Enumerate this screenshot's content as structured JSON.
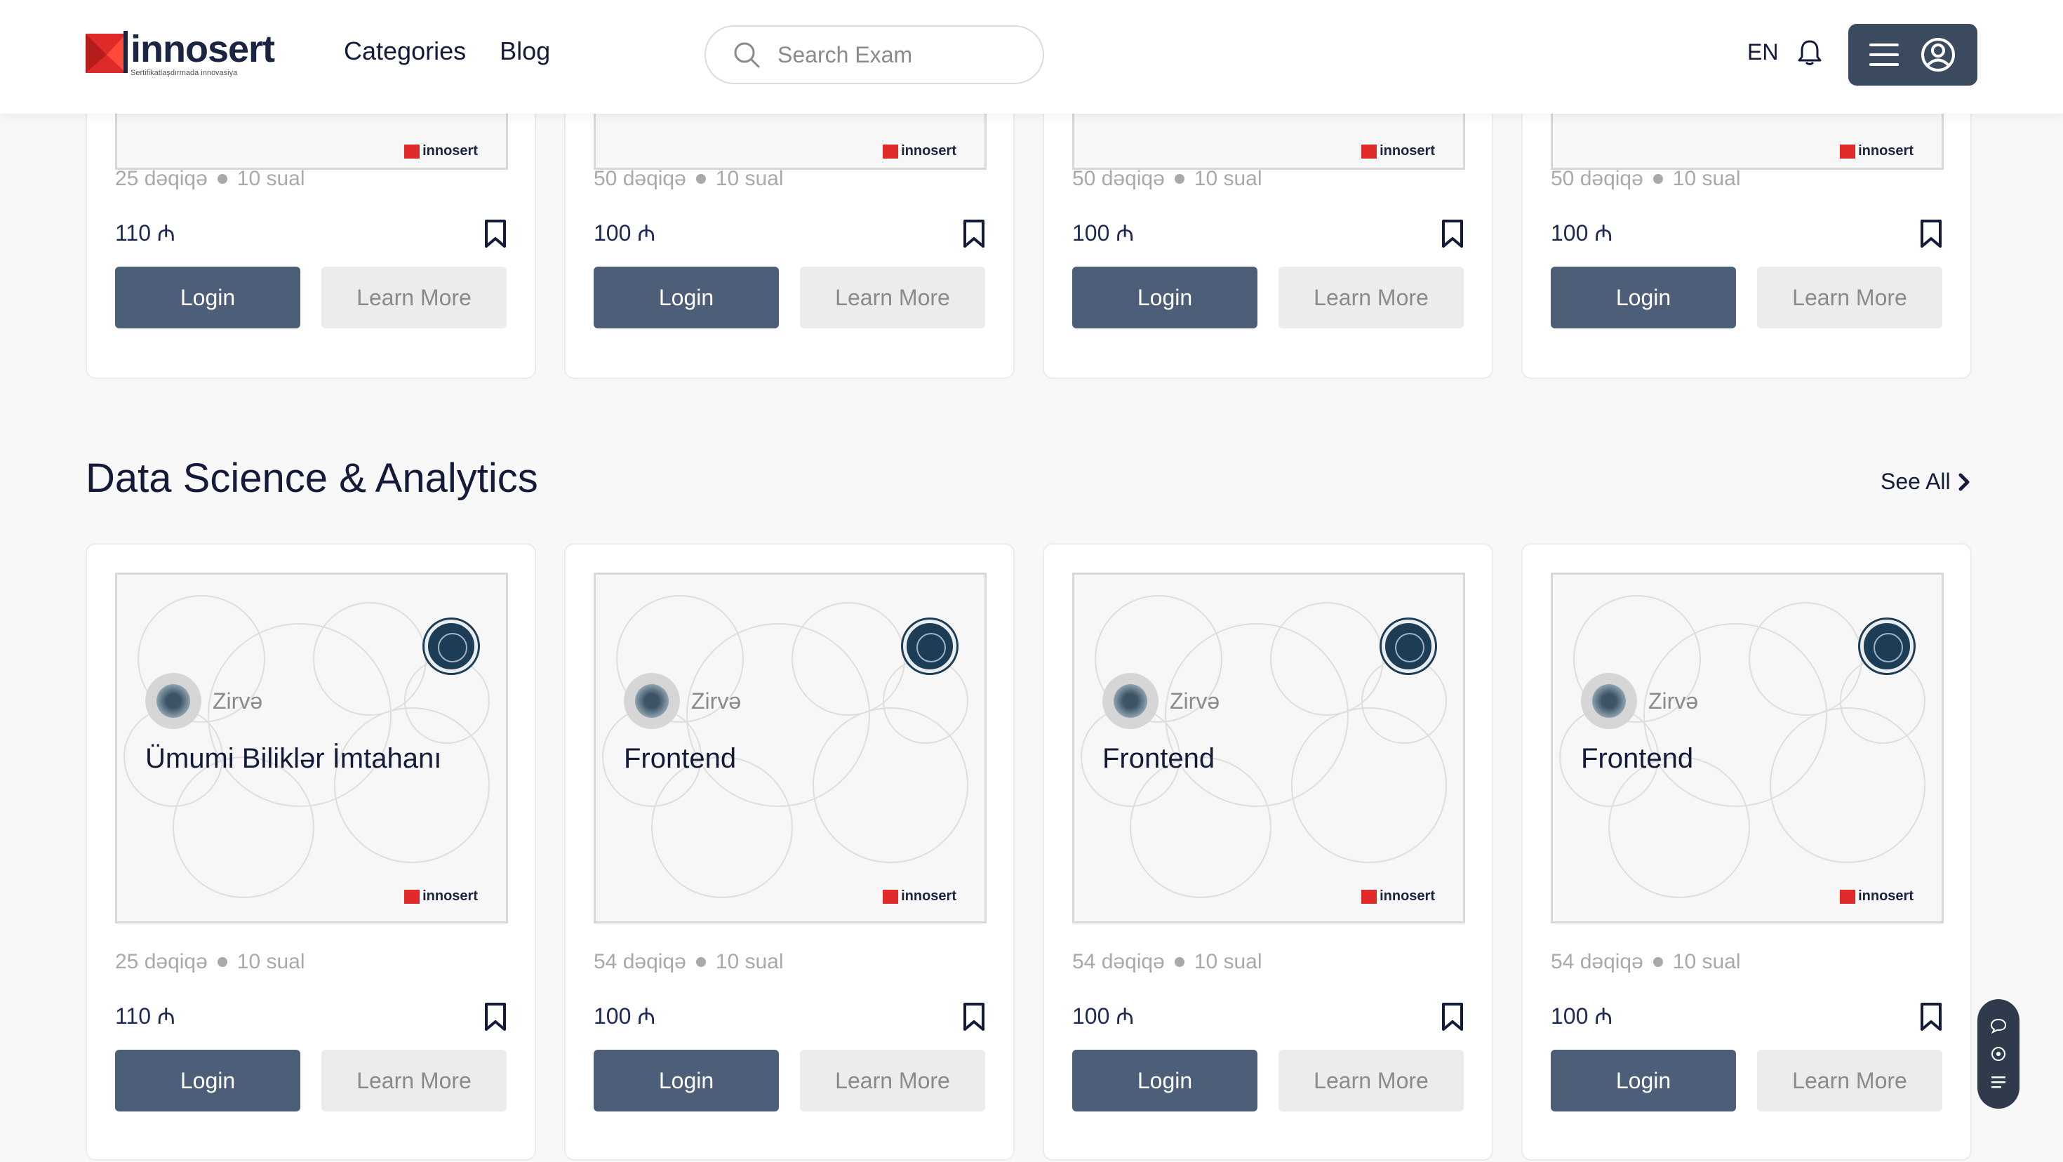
{
  "header": {
    "logo_name": "innosert",
    "logo_tagline": "Sertifikatlaşdırmada innovasiya",
    "nav": [
      "Categories",
      "Blog"
    ],
    "search_placeholder": "Search Exam",
    "lang": "EN"
  },
  "top_row": [
    {
      "thumb_logo": "innosert",
      "duration": "25 dəqiqə",
      "questions": "10 sual",
      "price": "110 ₼",
      "login": "Login",
      "learn": "Learn More"
    },
    {
      "thumb_logo": "innosert",
      "duration": "50 dəqiqə",
      "questions": "10 sual",
      "price": "100 ₼",
      "login": "Login",
      "learn": "Learn More"
    },
    {
      "thumb_logo": "innosert",
      "duration": "50 dəqiqə",
      "questions": "10 sual",
      "price": "100 ₼",
      "login": "Login",
      "learn": "Learn More"
    },
    {
      "thumb_logo": "innosert",
      "duration": "50 dəqiqə",
      "questions": "10 sual",
      "price": "100 ₼",
      "login": "Login",
      "learn": "Learn More"
    }
  ],
  "section": {
    "title": "Data Science & Analytics",
    "see_all": "See All"
  },
  "cards": [
    {
      "issuer": "Zirvə",
      "title": "Ümumi Biliklər İmtahanı",
      "thumb_logo": "innosert",
      "duration": "25 dəqiqə",
      "questions": "10 sual",
      "price": "110 ₼",
      "login": "Login",
      "learn": "Learn More"
    },
    {
      "issuer": "Zirvə",
      "title": "Frontend",
      "thumb_logo": "innosert",
      "duration": "54 dəqiqə",
      "questions": "10 sual",
      "price": "100 ₼",
      "login": "Login",
      "learn": "Learn More"
    },
    {
      "issuer": "Zirvə",
      "title": "Frontend",
      "thumb_logo": "innosert",
      "duration": "54 dəqiqə",
      "questions": "10 sual",
      "price": "100 ₼",
      "login": "Login",
      "learn": "Learn More"
    },
    {
      "issuer": "Zirvə",
      "title": "Frontend",
      "thumb_logo": "innosert",
      "duration": "54 dəqiqə",
      "questions": "10 sual",
      "price": "100 ₼",
      "login": "Login",
      "learn": "Learn More"
    }
  ],
  "colors": {
    "primary_button": "#4d5f78",
    "header_menu": "#3b4a5f",
    "brand_red": "#e02a2a",
    "text_dark": "#141a3a"
  },
  "icons": [
    "search-icon",
    "bell-icon",
    "hamburger-icon",
    "user-circle-icon",
    "bookmark-icon",
    "chevron-right-icon",
    "chat-icon",
    "eye-icon",
    "list-icon"
  ]
}
